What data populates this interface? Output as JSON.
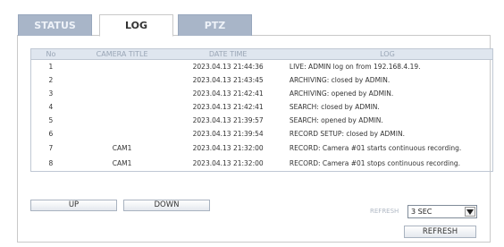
{
  "tabs": [
    {
      "label": "STATUS"
    },
    {
      "label": "LOG"
    },
    {
      "label": "PTZ"
    }
  ],
  "table": {
    "headers": [
      "No",
      "CAMERA TITLE",
      "DATE TIME",
      "LOG"
    ],
    "rows": [
      {
        "no": "1",
        "camera": "",
        "datetime": "2023.04.13  21:44:36",
        "log": "LIVE: ADMIN log on from 192.168.4.19."
      },
      {
        "no": "2",
        "camera": "",
        "datetime": "2023.04.13  21:43:45",
        "log": "ARCHIVING: closed by ADMIN."
      },
      {
        "no": "3",
        "camera": "",
        "datetime": "2023.04.13  21:42:41",
        "log": "ARCHIVING: opened by ADMIN."
      },
      {
        "no": "4",
        "camera": "",
        "datetime": "2023.04.13  21:42:41",
        "log": "SEARCH: closed by ADMIN."
      },
      {
        "no": "5",
        "camera": "",
        "datetime": "2023.04.13  21:39:57",
        "log": "SEARCH: opened by ADMIN."
      },
      {
        "no": "6",
        "camera": "",
        "datetime": "2023.04.13  21:39:54",
        "log": "RECORD SETUP: closed by ADMIN."
      },
      {
        "no": "7",
        "camera": "CAM1",
        "datetime": "2023.04.13  21:32:00",
        "log": "RECORD: Camera #01 starts continuous recording."
      },
      {
        "no": "8",
        "camera": "CAM1",
        "datetime": "2023.04.13  21:32:00",
        "log": "RECORD: Camera #01 stops continuous recording."
      }
    ]
  },
  "controls": {
    "up_label": "UP",
    "down_label": "DOWN",
    "refresh_label": "REFRESH",
    "refresh_interval": "3 SEC",
    "refresh_button": "REFRESH"
  },
  "select_arrow_icon": "chevron-down-icon"
}
